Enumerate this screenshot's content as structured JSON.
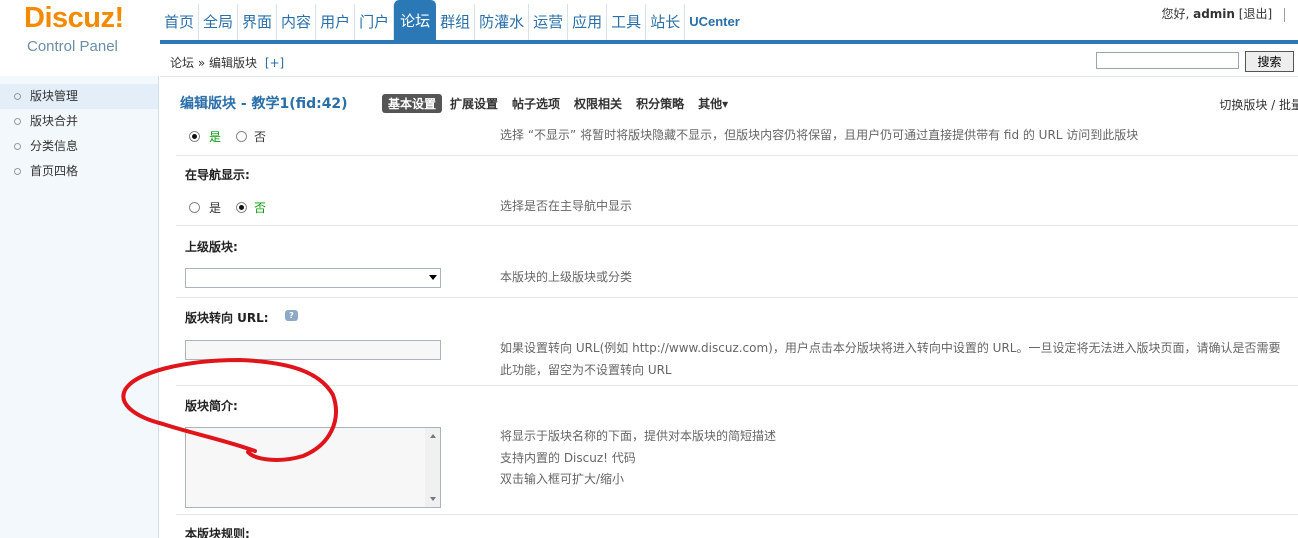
{
  "logo": {
    "main": "Discuz!",
    "sub": "Control Panel"
  },
  "nav": [
    {
      "label": "首页"
    },
    {
      "label": "全局"
    },
    {
      "label": "界面"
    },
    {
      "label": "内容"
    },
    {
      "label": "用户"
    },
    {
      "label": "门户"
    },
    {
      "label": "论坛",
      "active": true
    },
    {
      "label": "群组"
    },
    {
      "label": "防灌水"
    },
    {
      "label": "运营"
    },
    {
      "label": "应用"
    },
    {
      "label": "工具"
    },
    {
      "label": "站长"
    },
    {
      "label": "UCenter"
    }
  ],
  "user": {
    "greeting": "您好,",
    "name": "admin",
    "logout": "[退出]"
  },
  "sidebar": {
    "items": [
      {
        "label": "版块管理",
        "active": true
      },
      {
        "label": "版块合并"
      },
      {
        "label": "分类信息"
      },
      {
        "label": "首页四格"
      }
    ]
  },
  "breadcrumb": {
    "path": "论坛 » 编辑版块",
    "add": "[+]"
  },
  "search": {
    "button": "搜索",
    "value": ""
  },
  "page": {
    "title": "编辑版块 - 教学1(fid:42)",
    "tabs": [
      "基本设置",
      "扩展设置",
      "帖子选项",
      "权限相关",
      "积分策略",
      "其他▾"
    ],
    "right": "切换版块 / 批量"
  },
  "form": {
    "display": {
      "yes": "是",
      "no": "否",
      "tip": "选择 “不显示” 将暂时将版块隐藏不显示，但版块内容仍将保留，且用户仍可通过直接提供带有 fid 的 URL 访问到此版块"
    },
    "nav_display": {
      "label": "在导航显示:",
      "yes": "是",
      "no": "否",
      "tip": "选择是否在主导航中显示"
    },
    "parent": {
      "label": "上级版块:",
      "tip": "本版块的上级版块或分类"
    },
    "redirect": {
      "label": "版块转向 URL:",
      "tip1": "如果设置转向 URL(例如 http://www.discuz.com)，用户点击本分版块将进入转向中设置的 URL。一旦设定将无法进入版块页面，请确认是否需要",
      "tip2": "此功能，留空为不设置转向 URL"
    },
    "description": {
      "label": "版块简介:",
      "tip1": "将显示于版块名称的下面，提供对本版块的简短描述",
      "tip2": "支持内置的 Discuz! 代码",
      "tip3": "双击输入框可扩大/缩小"
    },
    "rules": {
      "label": "本版块规则:"
    }
  },
  "colors": {
    "accent": "#2a78b6",
    "logo": "#f38a00",
    "annotation": "#e0141b",
    "selected_radio": "#0a9a0a"
  }
}
